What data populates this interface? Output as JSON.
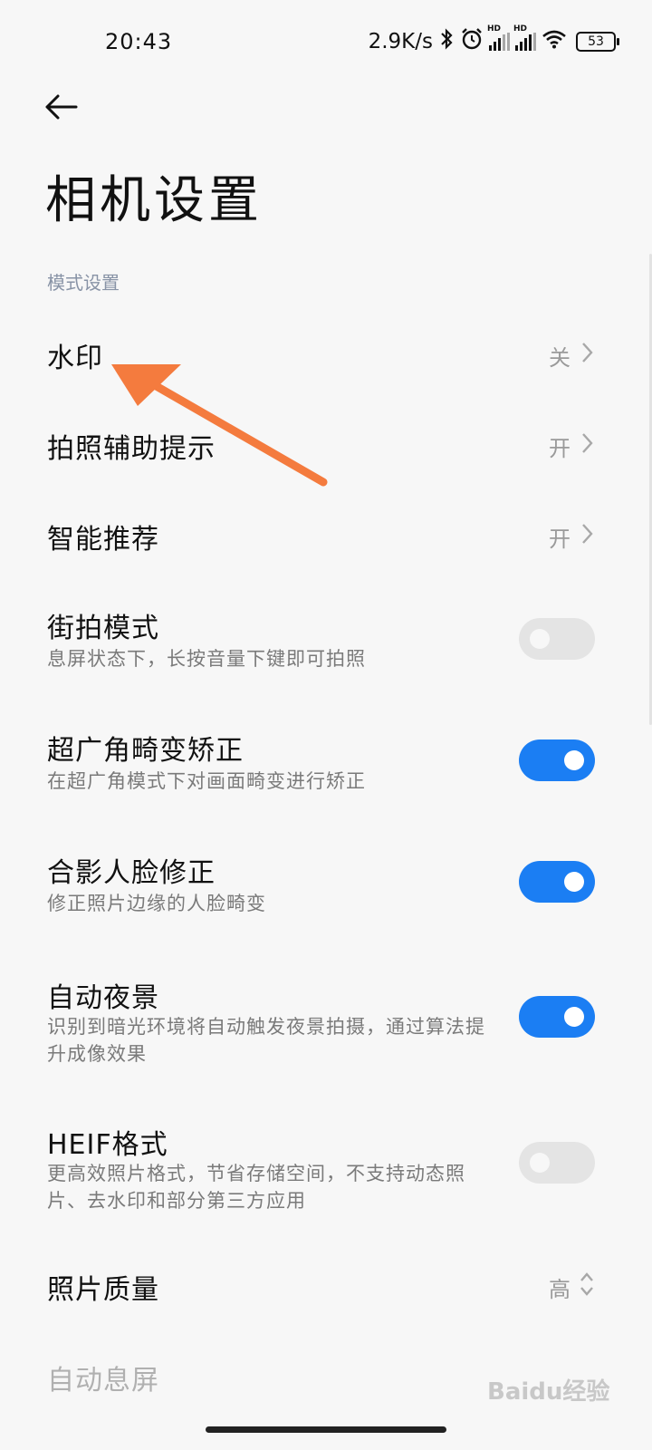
{
  "status_bar": {
    "time": "20:43",
    "net_speed": "2.9K/s",
    "battery": "53",
    "hd_label": "HD",
    "icons": [
      "bluetooth-icon",
      "alarm-icon",
      "signal-icon",
      "signal-icon",
      "wifi-icon",
      "battery-icon"
    ]
  },
  "header": {
    "back_icon": "arrow-left-icon",
    "title": "相机设置"
  },
  "section": {
    "label": "模式设置"
  },
  "settings": [
    {
      "title": "水印",
      "value": "关",
      "control": "chevron-right-icon"
    },
    {
      "title": "拍照辅助提示",
      "value": "开",
      "control": "chevron-right-icon"
    },
    {
      "title": "智能推荐",
      "value": "开",
      "control": "chevron-right-icon"
    },
    {
      "title": "街拍模式",
      "subtitle": "息屏状态下，长按音量下键即可拍照",
      "toggle": "off"
    },
    {
      "title": "超广角畸变矫正",
      "subtitle": "在超广角模式下对画面畸变进行矫正",
      "toggle": "on"
    },
    {
      "title": "合影人脸修正",
      "subtitle": "修正照片边缘的人脸畸变",
      "toggle": "on"
    },
    {
      "title": "自动夜景",
      "subtitle": "识别到暗光环境将自动触发夜景拍摄，通过算法提升成像效果",
      "toggle": "on"
    },
    {
      "title": "HEIF格式",
      "subtitle": "更高效照片格式，节省存储空间，不支持动态照片、去水印和部分第三方应用",
      "toggle": "off"
    },
    {
      "title": "照片质量",
      "value": "高",
      "control": "chevron-updown-icon"
    },
    {
      "title": "自动息屏"
    }
  ],
  "watermark_text": "Baidu经验",
  "colors": {
    "accent": "#1b7ef3",
    "toggle_off": "#e4e4e4",
    "annotation_arrow": "#f47b3e",
    "section_label": "#8893a6"
  }
}
